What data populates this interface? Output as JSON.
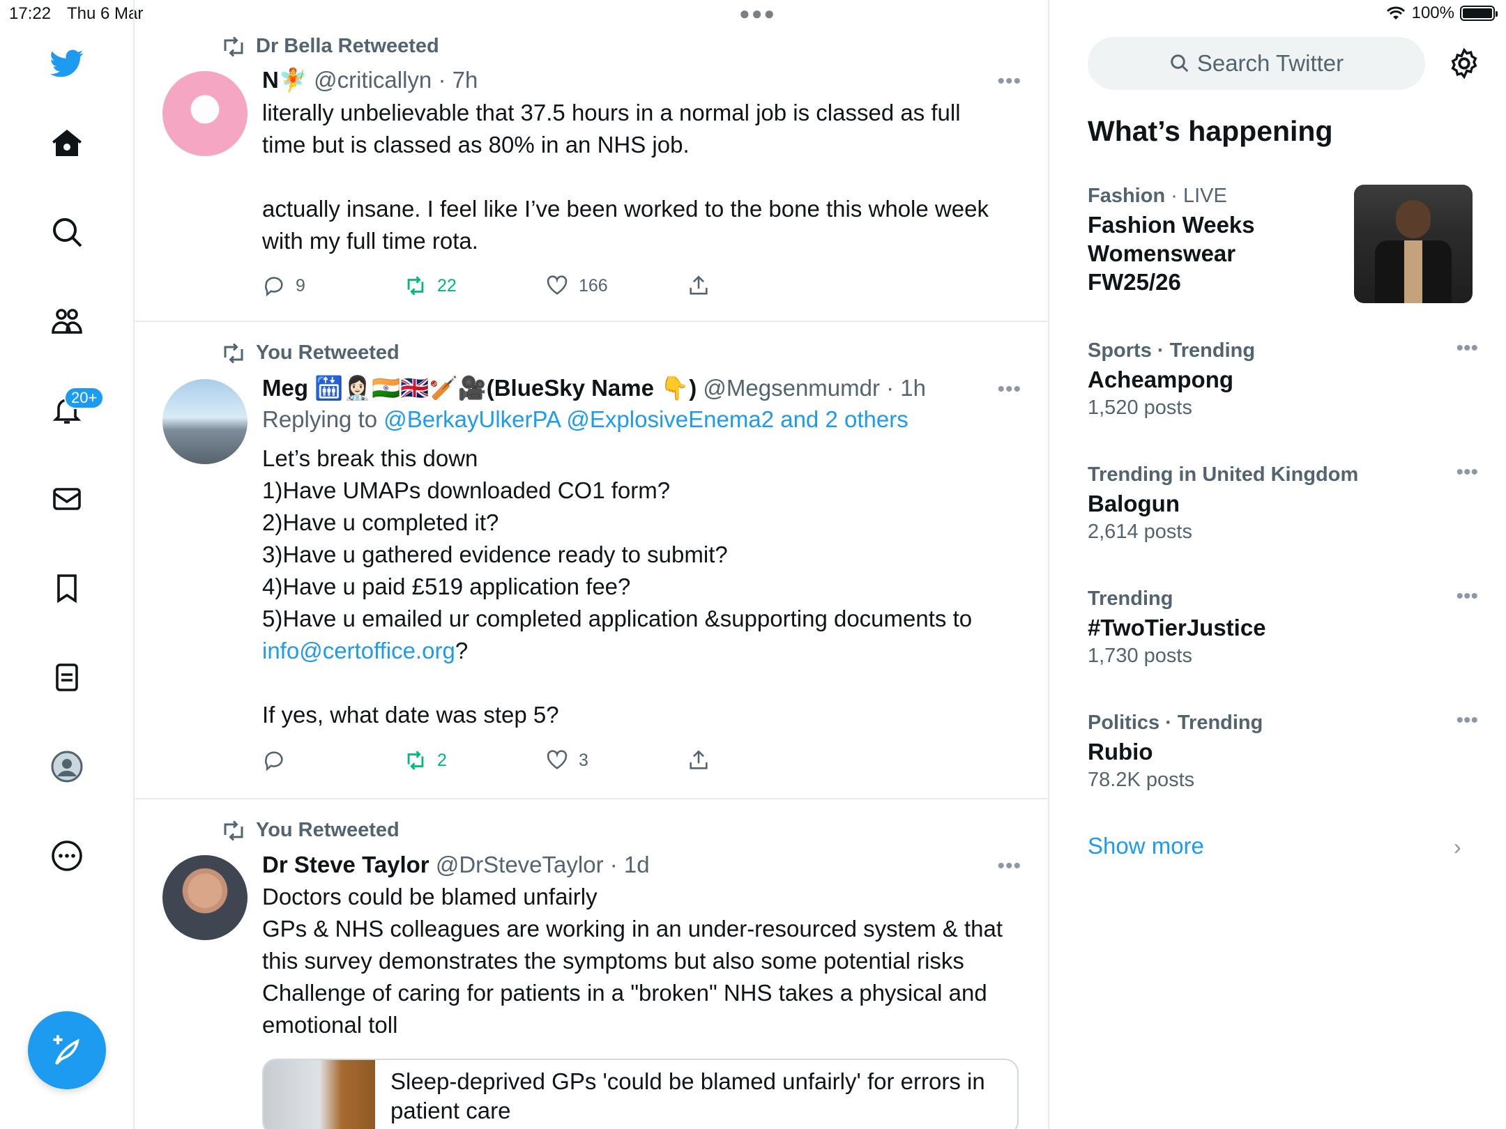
{
  "status": {
    "time": "17:22",
    "date": "Thu 6 Mar",
    "battery": "100%"
  },
  "nav": {
    "items": [
      "home-icon",
      "search-icon",
      "communities-icon",
      "notifications-icon",
      "messages-icon",
      "bookmarks-icon",
      "lists-icon",
      "profile-icon",
      "more-icon"
    ],
    "notification_badge": "20+"
  },
  "tweets": [
    {
      "retweeted_by": "Dr Bella Retweeted",
      "name": "N🧚",
      "handle": "@criticallyn · 7h",
      "lines": [
        "literally unbelievable that 37.5 hours in a normal job is classed as full",
        "time but is classed as 80% in an NHS job.",
        "",
        "actually insane. I feel like I’ve been worked to the bone this whole week",
        "with my full time rota."
      ],
      "replies": "9",
      "retweets": "22",
      "likes": "166"
    },
    {
      "retweeted_by": "You Retweeted",
      "name": "Meg 🛗👩🏻‍⚕️🇮🇳🇬🇧🏏🎥(BlueSky Name 👇)",
      "handle": "@Megsenmumdr · 1h",
      "replying_label": "Replying to",
      "replying_to": "@BerkayUlkerPA @ExplosiveEnema2 and 2 others",
      "lines": [
        "Let’s break this down",
        "1)Have UMAPs downloaded CO1 form?",
        "2)Have u completed it?",
        "3)Have u gathered evidence ready to submit?",
        "4)Have u paid £519 application fee?",
        "5)Have u emailed ur completed application &supporting documents to"
      ],
      "email": "info@certoffice.org",
      "email_suffix": "?",
      "last_line": "If yes, what date was step 5?",
      "replies": "",
      "retweets": "2",
      "likes": "3"
    },
    {
      "retweeted_by": "You Retweeted",
      "name": "Dr Steve Taylor",
      "handle": "@DrSteveTaylor · 1d",
      "lines": [
        "Doctors could be blamed unfairly",
        "GPs & NHS colleagues are working in an under-resourced system & that",
        "this survey demonstrates the symptoms but also some potential risks",
        "Challenge of caring for patients in a \"broken\" NHS takes a physical and",
        "emotional toll"
      ],
      "card_line1": "Sleep-deprived GPs 'could be blamed unfairly' for errors in",
      "card_line2": "patient care"
    }
  ],
  "sidebar": {
    "search_placeholder": "Search Twitter",
    "heading": "What’s happening",
    "trends": [
      {
        "category": "Fashion",
        "status": "LIVE",
        "title_lines": [
          "Fashion Weeks",
          "Womenswear",
          "FW25/26"
        ],
        "count": ""
      },
      {
        "category": "Sports · Trending",
        "title": "Acheampong",
        "count": "1,520 posts"
      },
      {
        "category": "Trending in United Kingdom",
        "title": "Balogun",
        "count": "2,614 posts"
      },
      {
        "category": "Trending",
        "title": "#TwoTierJustice",
        "count": "1,730 posts"
      },
      {
        "category": "Politics · Trending",
        "title": "Rubio",
        "count": "78.2K posts"
      }
    ],
    "show_more": "Show more"
  },
  "colors": {
    "accent": "#1d9bf0",
    "retweet_green": "#00ba7c",
    "muted": "#536471"
  }
}
